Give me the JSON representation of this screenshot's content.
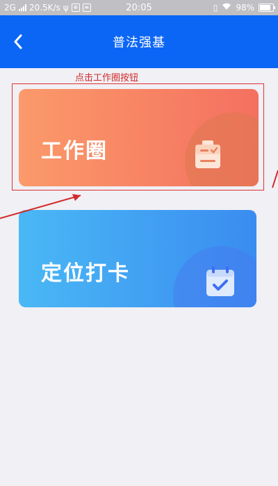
{
  "status_bar": {
    "network": "2G",
    "speed": "20.5K/s",
    "time": "20:05",
    "battery": "98%"
  },
  "header": {
    "title": "普法强基"
  },
  "annotation": {
    "text": "点击工作圈按钮"
  },
  "cards": [
    {
      "label": "工作圈",
      "icon": "clipboard-check-icon",
      "color_start": "#fb9a6a",
      "color_end": "#f47060"
    },
    {
      "label": "定位打卡",
      "icon": "calendar-check-icon",
      "color_start": "#4ab8f5",
      "color_end": "#3a8cf0"
    }
  ],
  "colors": {
    "header": "#0b66f5",
    "annotation": "#d22a2a",
    "background": "#f0f0f5"
  }
}
